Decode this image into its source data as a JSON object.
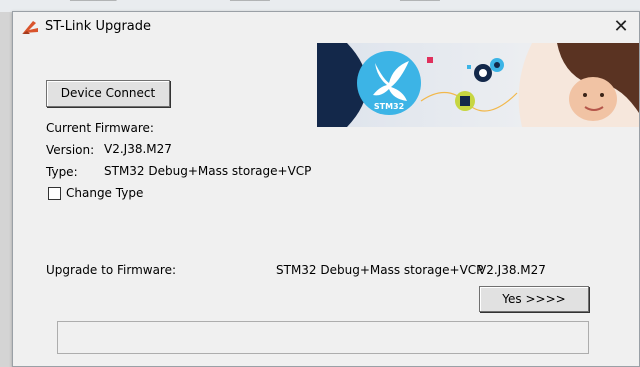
{
  "window": {
    "title": "ST-Link Upgrade",
    "close_glyph": "✕"
  },
  "buttons": {
    "device_connect": "Device Connect",
    "yes": "Yes >>>>"
  },
  "current": {
    "heading": "Current Firmware:",
    "version_label": "Version:",
    "version_value": "V2.J38.M27",
    "type_label": "Type:",
    "type_value": "STM32 Debug+Mass storage+VCP"
  },
  "change_type": {
    "label": "Change Type",
    "checked": false
  },
  "upgrade": {
    "label": "Upgrade to Firmware:",
    "type_value": "STM32 Debug+Mass storage+VCP",
    "version_value": "V2.J38.M27"
  },
  "banner": {
    "logo_text": "STM32"
  },
  "progress": {
    "value": 0
  },
  "colors": {
    "banner_navy": "#13284a",
    "stm_blue": "#3cb4e6",
    "window_bg": "#f0f0f0"
  }
}
